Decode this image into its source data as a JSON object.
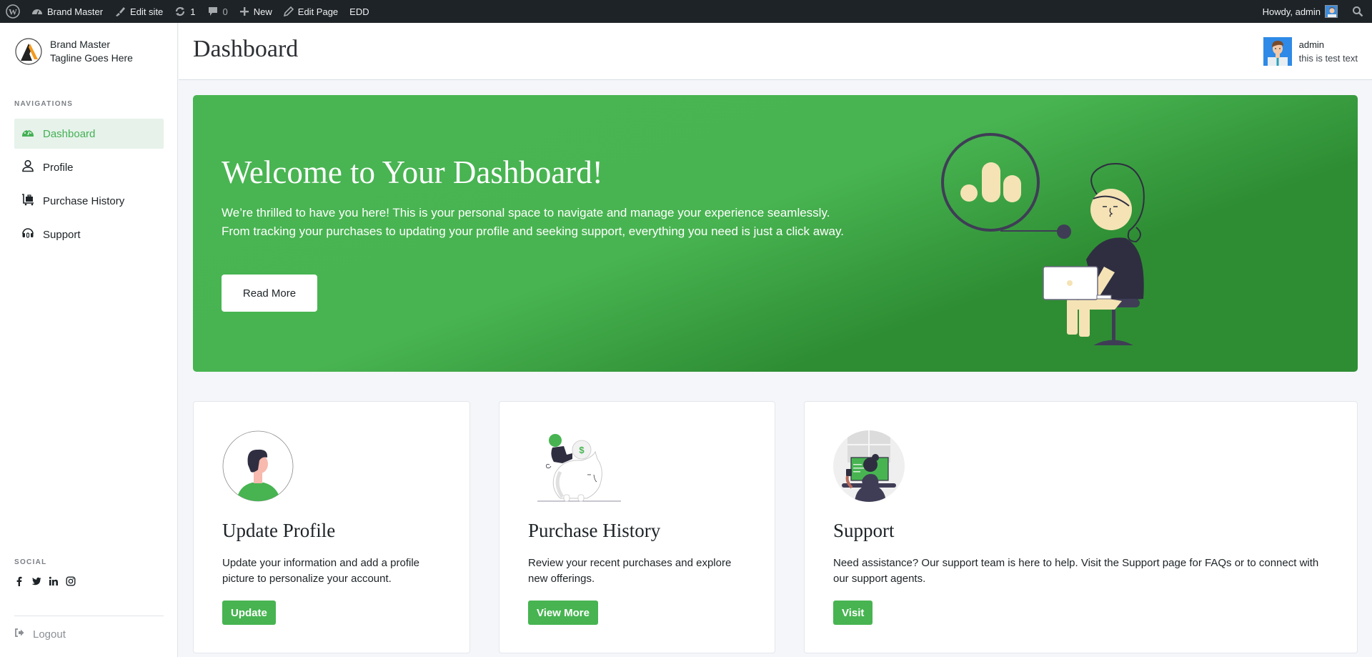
{
  "adminbar": {
    "site_name": "Brand Master",
    "edit_site": "Edit site",
    "updates_count": "1",
    "comments_count": "0",
    "new_label": "New",
    "edit_page": "Edit Page",
    "edd": "EDD",
    "howdy": "Howdy, admin"
  },
  "sidebar": {
    "brand_name": "Brand Master",
    "tagline": "Tagline Goes Here",
    "nav_heading": "NAVIGATIONS",
    "items": [
      {
        "label": "Dashboard",
        "icon": "dashboard-gauge-icon",
        "active": true
      },
      {
        "label": "Profile",
        "icon": "user-icon",
        "active": false
      },
      {
        "label": "Purchase History",
        "icon": "luggage-cart-icon",
        "active": false
      },
      {
        "label": "Support",
        "icon": "headset-icon",
        "active": false
      }
    ],
    "social_heading": "SOCIAL",
    "social": [
      "facebook-icon",
      "twitter-icon",
      "linkedin-icon",
      "instagram-icon"
    ],
    "logout": "Logout"
  },
  "header": {
    "title": "Dashboard",
    "user_name": "admin",
    "user_sub": "this is test text"
  },
  "hero": {
    "title": "Welcome to Your Dashboard!",
    "text": "We’re thrilled to have you here! This is your personal space to navigate and manage your experience seamlessly. From tracking your purchases to updating your profile and seeking support, everything you need is just a click away.",
    "button": "Read More"
  },
  "cards": [
    {
      "title": "Update Profile",
      "text": "Update your information and add a profile picture to personalize your account.",
      "button": "Update"
    },
    {
      "title": "Purchase History",
      "text": "Review your recent purchases and explore new offerings.",
      "button": "View More"
    },
    {
      "title": "Support",
      "text": "Need assistance? Our support team is here to help. Visit the Support page for FAQs or to connect with our support agents.",
      "button": "Visit"
    }
  ],
  "colors": {
    "accent": "#47b451",
    "hero_dark": "#2e8d33",
    "adminbar": "#1d2327"
  }
}
